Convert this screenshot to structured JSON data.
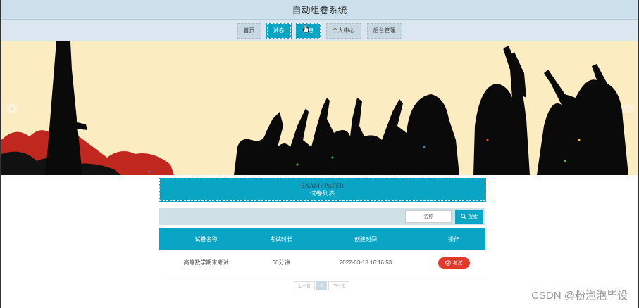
{
  "header": {
    "title": "自动组卷系统"
  },
  "nav": {
    "items": [
      {
        "label": "首页",
        "active": false
      },
      {
        "label": "试卷",
        "active": true
      },
      {
        "label": "信息",
        "active": true
      },
      {
        "label": "个人中心",
        "active": false
      },
      {
        "label": "后台管理",
        "active": false
      }
    ]
  },
  "section": {
    "title_en": "EXAM / PAPER",
    "title_cn": "试卷列表"
  },
  "search": {
    "placeholder": "名称",
    "button_label": "搜索"
  },
  "table": {
    "columns": [
      "试卷名称",
      "考试时长",
      "创建时间",
      "操作"
    ],
    "rows": [
      {
        "name": "高等数学期末考试",
        "duration": "60分钟",
        "created": "2022-03-18 16:16:53",
        "action": "考试"
      }
    ]
  },
  "pager": {
    "prev": "上一页",
    "current": "1",
    "next": "下一页"
  },
  "watermark": "CSDN @粉泡泡毕设",
  "colors": {
    "accent": "#0aa5c4",
    "danger": "#e03a2a",
    "banner_bg": "#fbecc2"
  }
}
